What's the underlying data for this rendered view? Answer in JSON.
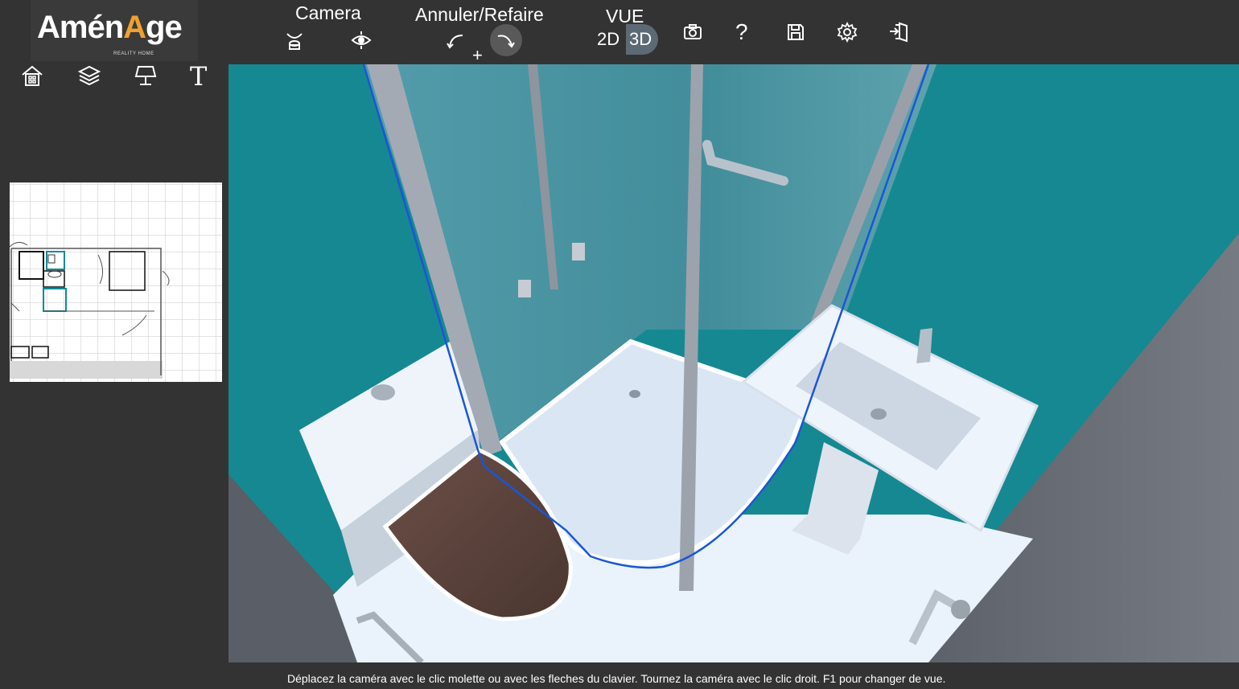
{
  "app": {
    "logo_main_prefix": "Amén",
    "logo_main_a": "A",
    "logo_main_suffix": "ge",
    "logo_sub": "REALITY HOME"
  },
  "toolbar": {
    "camera_label": "Camera",
    "undo_redo_label": "Annuler/Refaire",
    "undo_redo_plus": "+",
    "view_label": "VUE",
    "view_2d": "2D",
    "view_3d": "3D",
    "view_selected": "3D",
    "help_label": "?"
  },
  "sidebar": {
    "text_tool_label": "T"
  },
  "icons": {
    "camera_top": "camera-orbit-icon",
    "camera_eye": "camera-eye-icon",
    "undo": "undo-icon",
    "redo": "redo-icon",
    "screenshot": "screenshot-icon",
    "save": "save-icon",
    "settings": "gear-icon",
    "exit": "exit-icon",
    "home": "home-icon",
    "layers": "layers-icon",
    "lamp": "lamp-icon"
  },
  "colors": {
    "background": "#333333",
    "wall": "#1b8a94",
    "selection_outline": "#1a56d6",
    "logo_accent": "#f0a030",
    "toggle_active": "#5d6a75"
  },
  "status": {
    "hint": "Déplacez la caméra avec le clic molette ou avec les fleches du clavier. Tournez la caméra avec le clic droit. F1 pour changer de vue."
  }
}
